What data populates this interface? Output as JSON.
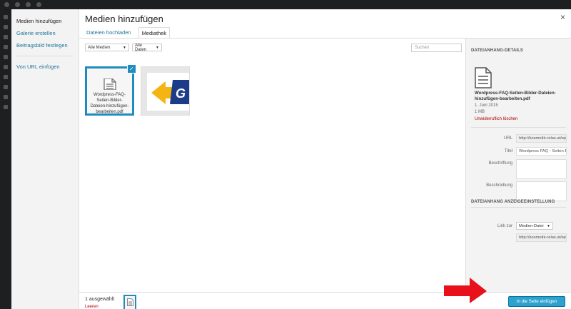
{
  "modal": {
    "title": "Medien hinzufügen",
    "close_icon": "×"
  },
  "menu": {
    "items": [
      "Medien hinzufügen",
      "Galerie erstellen",
      "Beitragsbild festlegen"
    ],
    "url_item": "Von URL einfügen"
  },
  "tabs": [
    "Dateien hochladen",
    "Mediathek"
  ],
  "toolbar": {
    "filter_media": "Alle Medien",
    "filter_date": "Alle Daten",
    "search_placeholder": "Suchen"
  },
  "attachments": [
    {
      "name": "Wordpress-FAQ-Seiten-Bilder-Dateien-hinzufügen-bearbeiten.pdf",
      "selected": true,
      "icon": "document-icon"
    },
    {
      "name": "",
      "selected": false,
      "icon": "image-thumbnail"
    }
  ],
  "details": {
    "heading": "DATEIANHANG-DETAILS",
    "filename": "Wordpress-FAQ-Seiten-Bilder-Dateien-hinzufügen-bearbeiten.pdf",
    "date": "1. Juni 2015",
    "size": "1 MB",
    "delete_link": "Unwiderruflich löschen",
    "url_label": "URL",
    "url_value": "http://kosmetik-relax.at/wp",
    "title_label": "Titel",
    "title_value": "Wordpress  FAQ - Seiten Bil",
    "caption_label": "Beschriftung",
    "description_label": "Beschreibung"
  },
  "display_settings": {
    "heading": "DATEIANHANG ANZEIGEEINSTELLUNG",
    "link_label": "Link zur",
    "link_value": "Medien-Datei",
    "link_url": "http://kosmetik-relax.at/wp"
  },
  "footer": {
    "selected_count": "1 ausgewählt",
    "clear_link": "Leeren",
    "insert_button": "In die Seite einfügen"
  },
  "colors": {
    "accent": "#1e8cbe",
    "button": "#2ea2cc",
    "link": "#21759b",
    "danger": "#a00000",
    "arrow": "#e8111b"
  }
}
